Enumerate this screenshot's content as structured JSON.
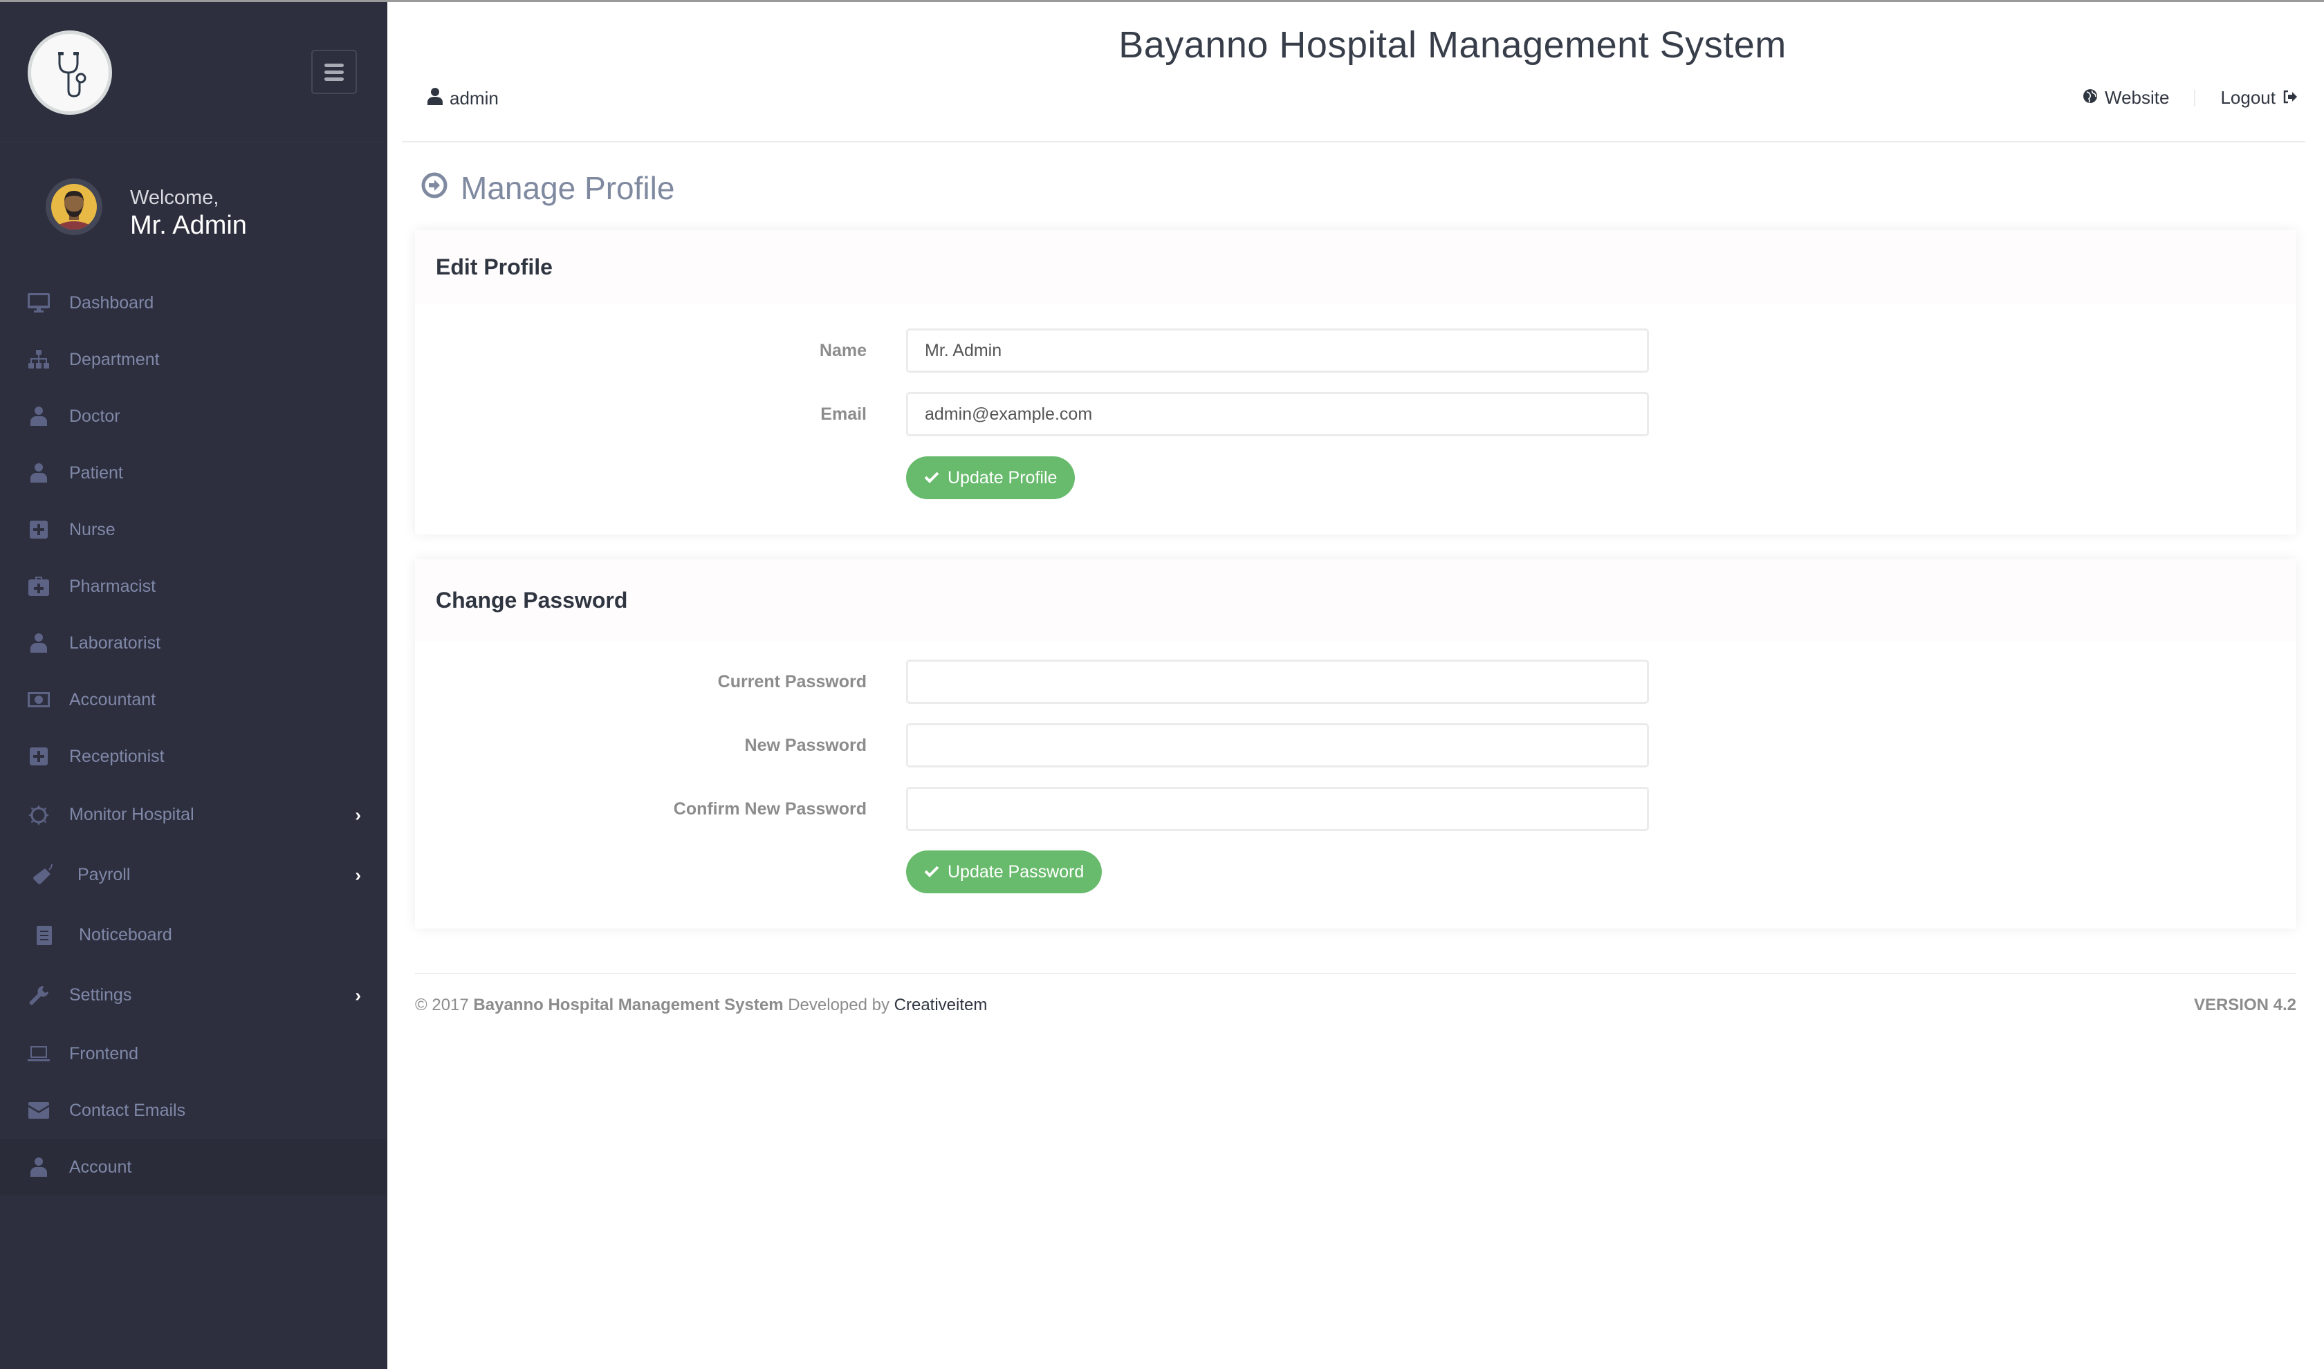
{
  "app": {
    "title": "Bayanno Hospital Management System"
  },
  "sidebar": {
    "welcome_text": "Welcome,",
    "user_name": "Mr. Admin",
    "items": [
      {
        "label": "Dashboard",
        "icon": "desktop-icon",
        "has_submenu": false
      },
      {
        "label": "Department",
        "icon": "sitemap-icon",
        "has_submenu": false
      },
      {
        "label": "Doctor",
        "icon": "doctor-icon",
        "has_submenu": false
      },
      {
        "label": "Patient",
        "icon": "user-icon",
        "has_submenu": false
      },
      {
        "label": "Nurse",
        "icon": "plus-square-icon",
        "has_submenu": false
      },
      {
        "label": "Pharmacist",
        "icon": "medkit-icon",
        "has_submenu": false
      },
      {
        "label": "Laboratorist",
        "icon": "user-icon",
        "has_submenu": false
      },
      {
        "label": "Accountant",
        "icon": "money-icon",
        "has_submenu": false
      },
      {
        "label": "Receptionist",
        "icon": "plus-square-icon",
        "has_submenu": false
      },
      {
        "label": "Monitor Hospital",
        "icon": "sun-icon",
        "has_submenu": true
      },
      {
        "label": "Payroll",
        "icon": "tag-icon",
        "has_submenu": true
      },
      {
        "label": "Noticeboard",
        "icon": "file-text-icon",
        "has_submenu": false
      },
      {
        "label": "Settings",
        "icon": "wrench-icon",
        "has_submenu": true
      },
      {
        "label": "Frontend",
        "icon": "laptop-icon",
        "has_submenu": false
      },
      {
        "label": "Contact Emails",
        "icon": "envelope-icon",
        "has_submenu": false
      },
      {
        "label": "Account",
        "icon": "user-icon",
        "has_submenu": false,
        "active": true
      }
    ]
  },
  "header": {
    "username": "admin",
    "website_label": "Website",
    "logout_label": "Logout"
  },
  "page": {
    "title": "Manage Profile"
  },
  "edit_profile": {
    "heading": "Edit Profile",
    "name_label": "Name",
    "name_value": "Mr. Admin",
    "email_label": "Email",
    "email_value": "admin@example.com",
    "submit_label": "Update Profile"
  },
  "change_password": {
    "heading": "Change Password",
    "current_label": "Current Password",
    "current_value": "",
    "new_label": "New Password",
    "new_value": "",
    "confirm_label": "Confirm New Password",
    "confirm_value": "",
    "submit_label": "Update Password"
  },
  "footer": {
    "copyright_prefix": "© 2017",
    "system_name": "Bayanno Hospital Management System",
    "developed_by": "Developed by",
    "developer": "Creativeitem",
    "version": "VERSION 4.2"
  },
  "colors": {
    "sidebar_bg": "#2d2f3e",
    "success": "#68bb6c",
    "page_title": "#7f8aa0"
  }
}
